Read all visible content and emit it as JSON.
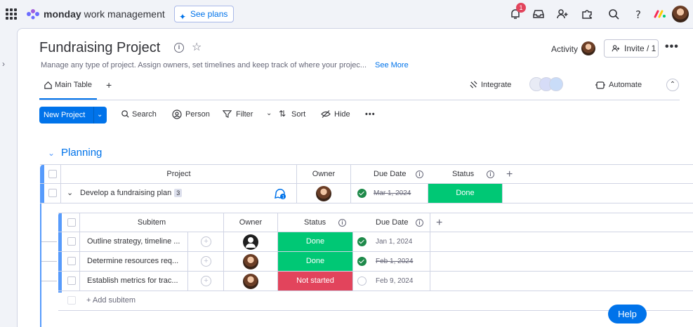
{
  "topbar": {
    "brand_bold": "monday",
    "brand_rest": " work management",
    "see_plans": "See plans",
    "notification_count": "1",
    "icons": [
      "apps-grid-icon",
      "monday-logo-icon",
      "sparkle-icon",
      "bell-icon",
      "inbox-icon",
      "invite-user-icon",
      "apps-marketplace-icon",
      "search-icon",
      "help-icon",
      "monday-products-icon",
      "avatar"
    ]
  },
  "board": {
    "title": "Fundraising Project",
    "description": "Manage any type of project. Assign owners, set timelines and keep track of where your projec...",
    "see_more": "See More",
    "activity": "Activity",
    "invite": "Invite / 1",
    "more": "•••"
  },
  "tabs": {
    "main_table": "Main Table",
    "add": "+",
    "integrate": "Integrate",
    "automate": "Automate"
  },
  "toolbar": {
    "new_project": "New Project",
    "search": "Search",
    "person": "Person",
    "filter": "Filter",
    "sort": "Sort",
    "hide": "Hide",
    "more": "•••"
  },
  "group": {
    "title": "Planning",
    "columns": {
      "project": "Project",
      "owner": "Owner",
      "due_date": "Due Date",
      "status": "Status"
    },
    "items": [
      {
        "name": "Develop a fundraising plan",
        "subitem_count": "3",
        "due_date": "Mar 1, 2024",
        "status": "Done"
      }
    ]
  },
  "subitems": {
    "columns": {
      "subitem": "Subitem",
      "owner": "Owner",
      "status": "Status",
      "due_date": "Due Date"
    },
    "rows": [
      {
        "name": "Outline strategy, timeline ...",
        "status": "Done",
        "due_date": "Jan 1, 2024"
      },
      {
        "name": "Determine resources req...",
        "status": "Done",
        "due_date": "Feb 1, 2024"
      },
      {
        "name": "Establish metrics for trac...",
        "status": "Not started",
        "due_date": "Feb 9, 2024"
      }
    ],
    "add_label": "+ Add subitem"
  },
  "help": "Help",
  "colors": {
    "accent": "#0073ea",
    "done": "#00c875",
    "not_started": "#e2445c",
    "group": "#579bfc"
  }
}
